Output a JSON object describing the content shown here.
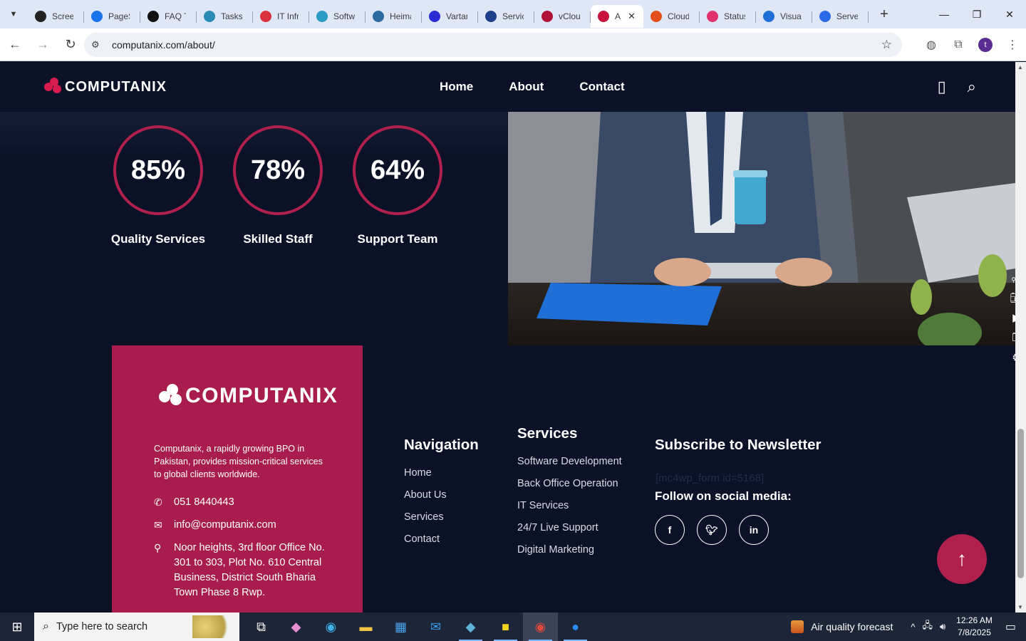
{
  "browser": {
    "tabs": [
      {
        "title": "Screen",
        "color": "#222"
      },
      {
        "title": "PageSpeed",
        "color": "#1a73e8"
      },
      {
        "title": "FAQ T",
        "color": "#111"
      },
      {
        "title": "Tasks",
        "color": "#2a8bb5"
      },
      {
        "title": "IT Infra",
        "color": "#d9313e"
      },
      {
        "title": "Software",
        "color": "#2a9bc4"
      },
      {
        "title": "Heimat",
        "color": "#2c6aa0"
      },
      {
        "title": "Vartan",
        "color": "#2b2bd6"
      },
      {
        "title": "Servic",
        "color": "#1d3f8c"
      },
      {
        "title": "vCloud",
        "color": "#b21237"
      },
      {
        "title": "A",
        "color": "#c8133d",
        "active": true
      },
      {
        "title": "Cloud",
        "color": "#e34e1b"
      },
      {
        "title": "Status",
        "color": "#e0326c"
      },
      {
        "title": "Visual",
        "color": "#1e6fd8"
      },
      {
        "title": "Serve",
        "color": "#2a6ae8"
      }
    ],
    "url": "computanix.com/about/",
    "profile_initial": "t"
  },
  "site": {
    "logo": "COMPUTANIX",
    "nav": {
      "home": "Home",
      "about": "About",
      "contact": "Contact"
    },
    "stats": [
      {
        "value": "85%",
        "label": "Quality Services"
      },
      {
        "value": "78%",
        "label": "Skilled Staff"
      },
      {
        "value": "64%",
        "label": "Support Team"
      }
    ],
    "footer": {
      "logo": "COMPUTANIX",
      "description": "Computanix, a rapidly growing BPO in Pakistan, provides mission-critical services to global clients worldwide.",
      "phone": "051 8440443",
      "email": "info@computanix.com",
      "address": "Noor heights, 3rd floor Office No. 301 to 303, Plot No. 610 Central Business, District South Bharia Town Phase 8 Rwp.",
      "navigation": {
        "title": "Navigation",
        "links": [
          "Home",
          "About Us",
          "Services",
          "Contact"
        ]
      },
      "services": {
        "title": "Services",
        "links": [
          "Software Development",
          "Back Office Operation",
          "IT Services",
          "24/7 Live Support",
          "Digital Marketing"
        ]
      },
      "newsletter": {
        "title": "Subscribe to Newsletter",
        "shortcode": "[mc4wp_form id=5168]",
        "follow": "Follow on social media:",
        "socials": [
          "f",
          "t",
          "in"
        ]
      }
    }
  },
  "taskbar": {
    "search_placeholder": "Type here to search",
    "weather": "Air quality forecast",
    "time": "12:26 AM",
    "date": "7/8/2025"
  }
}
